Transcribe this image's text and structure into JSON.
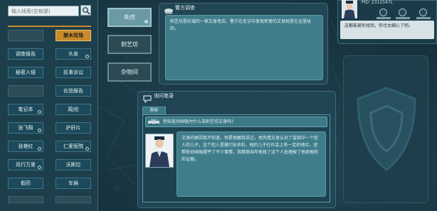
{
  "search": {
    "placeholder": "输入线索(空格键)"
  },
  "clue_grid": [
    {
      "label": "",
      "state": "empty"
    },
    {
      "label": "禁木坟场",
      "state": "selected"
    },
    {
      "label": "调查报告",
      "state": "normal"
    },
    {
      "label": "头发",
      "state": "normal"
    },
    {
      "label": "秘密入侵",
      "state": "normal"
    },
    {
      "label": "民事诉讼",
      "state": "normal"
    },
    {
      "label": "",
      "state": "empty"
    },
    {
      "label": "化验报告",
      "state": "normal"
    },
    {
      "label": "笔记本",
      "state": "normal"
    },
    {
      "label": "周J伦",
      "state": "normal"
    },
    {
      "label": "张飞翔",
      "state": "normal"
    },
    {
      "label": "护肝片",
      "state": "normal"
    },
    {
      "label": "张艳红",
      "state": "normal"
    },
    {
      "label": "仁爱医院",
      "state": "normal"
    },
    {
      "label": "风行万里",
      "state": "normal"
    },
    {
      "label": "沃斯拉",
      "state": "normal"
    },
    {
      "label": "假药",
      "state": "normal"
    },
    {
      "label": "车祸",
      "state": "normal"
    }
  ],
  "clue_tabs": [
    {
      "label": "朱然",
      "active": true
    },
    {
      "label": "刺艺坊",
      "active": false
    },
    {
      "label": "杂物间",
      "active": false
    }
  ],
  "investigation": {
    "title": "警方调查",
    "text": "刺艺坊是纺城的一家文身老店，警方在走访中发现死者的文身就是在这里纹的。"
  },
  "inquiry": {
    "title": "询问笔录",
    "tab_label": "焦彬",
    "question": "你知道孙国强为什么去刺艺坊文身吗?",
    "answer": "文身的原因我不知道，但是他跟我说过，他凭借文身认识了监狱中一个犯人的儿子，这个犯人是做IT技术的，他的儿子在社会上有一定的地位，还帮助孙国强摆平了不少事情，我猜测当年他找了这个人处理掉了他卖假药的证据。"
  },
  "player": {
    "pid": "PID: 2312547L",
    "message": "这都能被你找到，你也太细心了吧。"
  },
  "colors": {
    "accent": "#c98a2a",
    "panel": "#214553",
    "inner": "#3f7d8b"
  }
}
